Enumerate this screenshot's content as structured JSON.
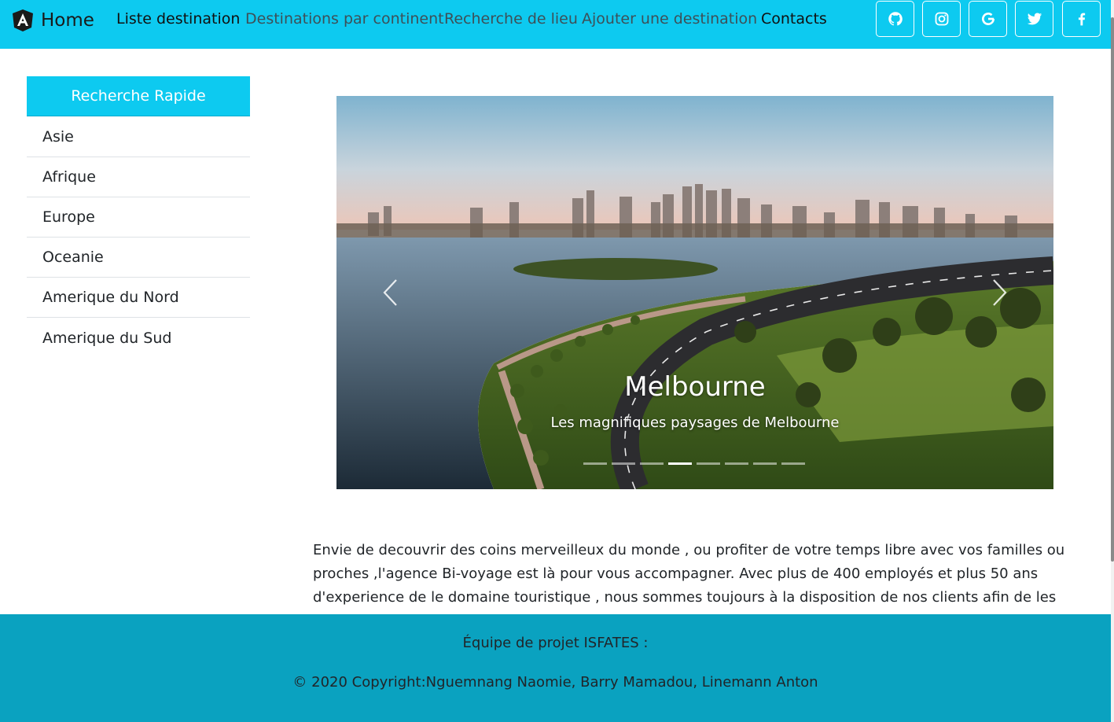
{
  "navbar": {
    "brand_label": "Home",
    "links": [
      "Liste destination",
      "Destinations par continent",
      "Recherche de lieu",
      "Ajouter une destination",
      "Contacts"
    ],
    "social_icons": [
      "github-icon",
      "instagram-icon",
      "google-icon",
      "twitter-icon",
      "facebook-icon"
    ],
    "colors": {
      "bar": "#0dcaf0",
      "active_link": "#111111",
      "link": "#3d5058"
    }
  },
  "sidebar": {
    "title": "Recherche Rapide",
    "items": [
      "Asie",
      "Afrique",
      "Europe",
      "Oceanie",
      "Amerique du Nord",
      "Amerique du Sud"
    ]
  },
  "carousel": {
    "title": "Melbourne",
    "caption": "Les magnifiques paysages de Melbourne",
    "slide_count": 8,
    "active_slide": 4,
    "prev_icon": "chevron-left-icon",
    "next_icon": "chevron-right-icon"
  },
  "intro": {
    "text": "Envie de decouvrir des coins merveilleux du monde , ou profiter de votre temps libre avec vos familles ou proches ,l'agence Bi-voyage est là pour vous accompagner. Avec plus de 400 employés et plus 50 ans d'experience de le domaine touristique , nous sommes toujours à la disposition de nos clients afin de les offir"
  },
  "footer": {
    "team": "Équipe de projet ISFATES :",
    "copyright": "© 2020 Copyright:Nguemnang Naomie, Barry Mamadou, Linemann Anton",
    "color": "#0aa2c0"
  }
}
